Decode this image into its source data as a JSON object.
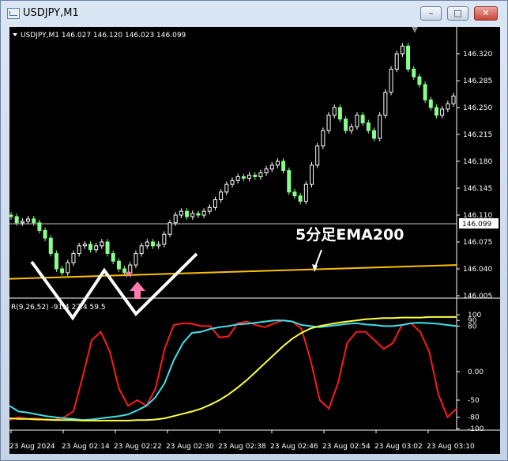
{
  "window": {
    "title": "USDJPY,M1",
    "icons": [
      "chart-window-icon",
      "minimize-icon",
      "maximize-icon",
      "close-icon"
    ]
  },
  "chart": {
    "symbol_info": "USDJPY,M1  146.027 146.120 146.023 146.099",
    "annotation": "5分足EMA200",
    "indicator_label": "R(9,26,52) -91.4  27.4 59.5",
    "current_price": "146.099",
    "colors": {
      "background": "#000000",
      "bull_candle": "#ffffff",
      "bear_candle": "#88ff88",
      "ema": "#ffc000",
      "red_line": "#ff1a1a",
      "cyan_line": "#40e0e8",
      "yellow_line": "#ffff40",
      "w_pattern": "#ffffff",
      "pink_marker": "#ff7ab0"
    }
  },
  "chart_data": [
    {
      "type": "candlestick",
      "y_ticks": [
        "146.320",
        "146.285",
        "146.250",
        "146.215",
        "146.180",
        "146.145",
        "146.110",
        "146.075",
        "146.040",
        "146.005"
      ],
      "ylim": [
        146.005,
        146.34
      ],
      "x_ticks": [
        "23 Aug 2024",
        "23 Aug 02:14",
        "23 Aug 02:22",
        "23 Aug 02:30",
        "23 Aug 02:38",
        "23 Aug 02:46",
        "23 Aug 02:54",
        "23 Aug 03:02",
        "23 Aug 03:10"
      ],
      "ema200_start": 146.027,
      "ema200_end": 146.045
    },
    {
      "type": "line",
      "y_ticks": [
        "100",
        "90",
        "80",
        "0.00",
        "-50",
        "-80",
        "-100"
      ],
      "ylim": [
        -100,
        100
      ],
      "series": [
        {
          "color": "#ff1a1a",
          "values": [
            -85,
            -80,
            -83,
            -82,
            -85,
            -84,
            -80,
            -70,
            -10,
            55,
            70,
            35,
            -30,
            -60,
            -50,
            -60,
            -30,
            40,
            82,
            85,
            84,
            80,
            80,
            60,
            62,
            85,
            88,
            82,
            78,
            85,
            90,
            88,
            75,
            20,
            -50,
            -65,
            -20,
            50,
            70,
            70,
            55,
            40,
            50,
            82,
            85,
            70,
            35,
            -40,
            -80,
            -65
          ]
        },
        {
          "color": "#40e0e8",
          "values": [
            -60,
            -70,
            -72,
            -75,
            -78,
            -80,
            -82,
            -83,
            -85,
            -84,
            -82,
            -80,
            -78,
            -75,
            -68,
            -60,
            -45,
            -20,
            20,
            50,
            68,
            70,
            75,
            78,
            80,
            83,
            84,
            86,
            88,
            90,
            90,
            88,
            82,
            80,
            78,
            80,
            82,
            84,
            85,
            83,
            82,
            80,
            80,
            82,
            85,
            86,
            85,
            84,
            82,
            80
          ]
        },
        {
          "color": "#ffff40",
          "values": [
            -82,
            -83,
            -83,
            -84,
            -84,
            -85,
            -85,
            -85,
            -86,
            -86,
            -86,
            -86,
            -86,
            -86,
            -85,
            -85,
            -84,
            -82,
            -78,
            -74,
            -70,
            -65,
            -58,
            -50,
            -40,
            -28,
            -15,
            0,
            15,
            30,
            45,
            58,
            68,
            76,
            80,
            83,
            86,
            88,
            90,
            92,
            93,
            94,
            94,
            95,
            95,
            95,
            96,
            96,
            96,
            96
          ]
        }
      ]
    }
  ]
}
